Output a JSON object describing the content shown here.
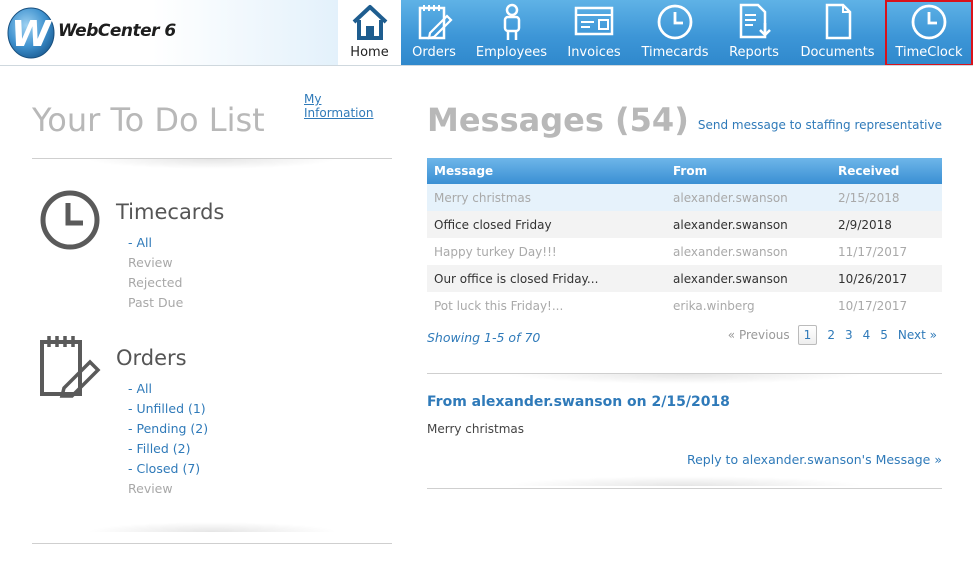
{
  "app": {
    "logo_letter": "W",
    "logo_text": "WebCenter 6"
  },
  "nav": {
    "items": [
      {
        "label": "Home",
        "icon": "home-icon",
        "active": true
      },
      {
        "label": "Orders",
        "icon": "orders-notepad-icon"
      },
      {
        "label": "Employees",
        "icon": "employee-person-icon"
      },
      {
        "label": "Invoices",
        "icon": "invoice-card-icon"
      },
      {
        "label": "Timecards",
        "icon": "clock-icon"
      },
      {
        "label": "Reports",
        "icon": "report-download-icon"
      },
      {
        "label": "Documents",
        "icon": "document-icon"
      },
      {
        "label": "TimeClock",
        "icon": "timeclock-icon",
        "highlighted": true
      }
    ],
    "colors": {
      "nav_top": "#5fb2e6",
      "nav_bottom": "#2f88cc",
      "highlight_border": "#d9121b"
    }
  },
  "todo": {
    "title": "Your To Do List",
    "my_info_link": "My Information",
    "timecards": {
      "title": "Timecards",
      "items": [
        {
          "label": "- All",
          "link": true
        },
        {
          "label": "Review",
          "link": false
        },
        {
          "label": "Rejected",
          "link": false
        },
        {
          "label": "Past Due",
          "link": false
        }
      ]
    },
    "orders": {
      "title": "Orders",
      "items": [
        {
          "label": "- All",
          "link": true
        },
        {
          "label": "- Unfilled (1)",
          "link": true
        },
        {
          "label": "- Pending (2)",
          "link": true
        },
        {
          "label": "- Filled (2)",
          "link": true
        },
        {
          "label": "- Closed (7)",
          "link": true
        },
        {
          "label": "Review",
          "link": false
        }
      ]
    }
  },
  "messages": {
    "title": "Messages (54)",
    "send_link": "Send message to staffing representative",
    "columns": [
      "Message",
      "From",
      "Received"
    ],
    "rows": [
      {
        "message": "Merry christmas",
        "from": "alexander.swanson",
        "received": "2/15/2018",
        "read": true,
        "selected": true
      },
      {
        "message": "Office closed Friday",
        "from": "alexander.swanson",
        "received": "2/9/2018",
        "read": false
      },
      {
        "message": "Happy turkey Day!!!",
        "from": "alexander.swanson",
        "received": "11/17/2017",
        "read": true
      },
      {
        "message": "Our office is closed Friday...",
        "from": "alexander.swanson",
        "received": "10/26/2017",
        "read": false
      },
      {
        "message": "Pot luck this Friday!...",
        "from": "erika.winberg",
        "received": "10/17/2017",
        "read": true
      }
    ],
    "showing": "Showing 1-5 of 70",
    "pager": {
      "prev": "« Previous",
      "pages": [
        "1",
        "2",
        "3",
        "4",
        "5"
      ],
      "current": "1",
      "next": "Next »"
    },
    "detail": {
      "from_line": "From alexander.swanson on 2/15/2018",
      "body": "Merry christmas",
      "reply_link": "Reply to alexander.swanson's Message »"
    },
    "colors": {
      "link": "#2f7ab9",
      "header_bg": "#3a8fd3",
      "selected_row": "#e6f2fb"
    }
  }
}
